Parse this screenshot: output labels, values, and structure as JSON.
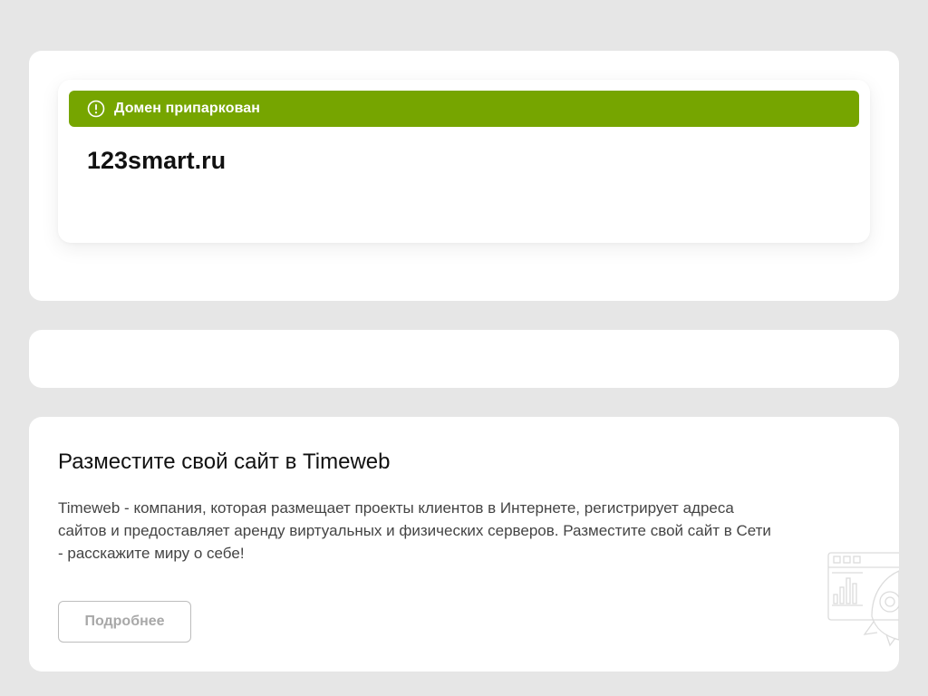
{
  "parking": {
    "status_label": "Домен припаркован",
    "status_icon": "exclamation-circle-icon",
    "domain": "123smart.ru",
    "accent_color": "#76a500"
  },
  "promo": {
    "title": "Разместите свой сайт в Timeweb",
    "text": "Timeweb - компания, которая размещает проекты клиентов в Интернете, регистрирует адреса сайтов и предоставляет аренду виртуальных и физических серверов. Разместите свой сайт в Сети - расскажите миру о себе!",
    "button_label": "Подробнее",
    "illustration_icon": "rocket-browser-icon"
  }
}
